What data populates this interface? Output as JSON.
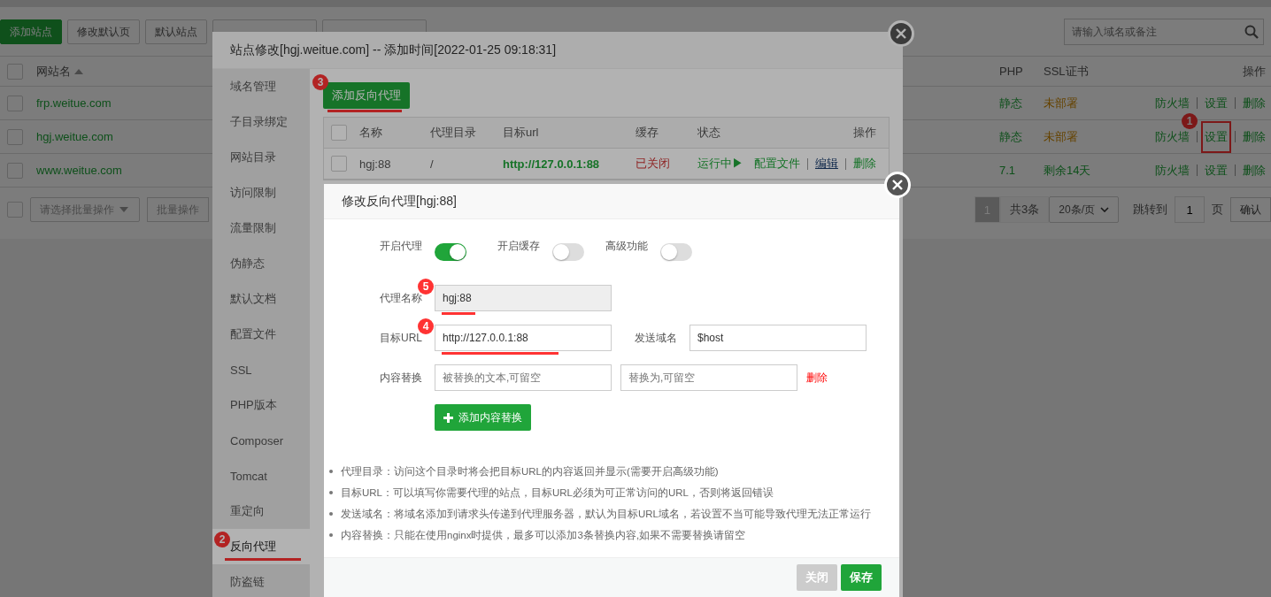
{
  "toolbar": {
    "buttons": [
      {
        "label": "添加站点",
        "primary": true
      },
      {
        "label": "修改默认页",
        "primary": false
      },
      {
        "label": "默认站点",
        "primary": false
      }
    ],
    "search": {
      "placeholder": "请输入域名或备注"
    }
  },
  "sites": {
    "columns": [
      "网站名",
      "PHP",
      "SSL证书",
      "操作"
    ],
    "header_checked": false,
    "footer_checked": false,
    "rows": [
      {
        "checked": false,
        "name": "frp.weitue.com",
        "php": "静态",
        "ssl": "未部署",
        "ssl_ok": false,
        "ops": [
          {
            "label": "防火墙"
          },
          {
            "label": "设置"
          },
          {
            "label": "删除"
          }
        ]
      },
      {
        "checked": false,
        "name": "hgj.weitue.com",
        "php": "静态",
        "ssl": "未部署",
        "ssl_ok": false,
        "ops": [
          {
            "label": "防火墙"
          },
          {
            "label": "设置",
            "badge": "1"
          },
          {
            "label": "删除"
          }
        ]
      },
      {
        "checked": false,
        "name": "www.weitue.com",
        "php": "7.1",
        "ssl": "剩余14天",
        "ssl_ok": true,
        "ops": [
          {
            "label": "防火墙"
          },
          {
            "label": "设置"
          },
          {
            "label": "删除"
          }
        ]
      }
    ],
    "batch_placeholder": "请选择批量操作",
    "batch_button": "批量操作",
    "pager": {
      "page": "1",
      "total": "共3条",
      "per_page": "20条/页",
      "jump": "跳转到",
      "jump_value": "1",
      "unit": "页",
      "confirm": "确认"
    }
  },
  "site_dialog": {
    "title": "站点修改[hgj.weitue.com] -- 添加时间[2022-01-25 09:18:31]",
    "menu": [
      {
        "label": "域名管理",
        "selected": false
      },
      {
        "label": "子目录绑定",
        "selected": false
      },
      {
        "label": "网站目录",
        "selected": false
      },
      {
        "label": "访问限制",
        "selected": false
      },
      {
        "label": "流量限制",
        "selected": false
      },
      {
        "label": "伪静态",
        "selected": false
      },
      {
        "label": "默认文档",
        "selected": false
      },
      {
        "label": "配置文件",
        "selected": false
      },
      {
        "label": "SSL",
        "selected": false
      },
      {
        "label": "PHP版本",
        "selected": false
      },
      {
        "label": "Composer",
        "selected": false
      },
      {
        "label": "Tomcat",
        "selected": false
      },
      {
        "label": "重定向",
        "selected": false
      },
      {
        "label": "反向代理",
        "selected": true,
        "badge": "2"
      },
      {
        "label": "防盗链",
        "selected": false
      }
    ],
    "add_button": {
      "label": "添加反向代理",
      "badge": "3"
    },
    "columns": [
      "名称",
      "代理目录",
      "目标url",
      "缓存",
      "状态",
      "操作"
    ],
    "header_checked": false,
    "rows": [
      {
        "checked": false,
        "name": "hgj:88",
        "dir": "/",
        "url": "http://127.0.0.1:88",
        "cache": "已关闭",
        "status": "运行中▶",
        "ops": [
          {
            "label": "配置文件",
            "underlined": false
          },
          {
            "label": "编辑",
            "underlined": true
          },
          {
            "label": "删除",
            "underlined": false
          }
        ]
      }
    ]
  },
  "proxy_dialog": {
    "title": "修改反向代理[hgj:88]",
    "switches": [
      {
        "label": "开启代理",
        "on": true
      },
      {
        "label": "开启缓存",
        "on": false
      },
      {
        "label": "高级功能",
        "on": false
      }
    ],
    "name_field": {
      "label": "代理名称",
      "value": "hgj:88",
      "disabled": true,
      "badge": "5"
    },
    "url_field": {
      "label": "目标URL",
      "value": "http://127.0.0.1:88",
      "badge": "4"
    },
    "host_field": {
      "label": "发送域名",
      "value": "$host"
    },
    "replace": {
      "label": "内容替换",
      "from_placeholder": "被替换的文本,可留空",
      "to_placeholder": "替换为,可留空",
      "delete": "删除"
    },
    "add_replace": "添加内容替换",
    "notes": [
      "代理目录：访问这个目录时将会把目标URL的内容返回并显示(需要开启高级功能)",
      "目标URL：可以填写你需要代理的站点，目标URL必须为可正常访问的URL，否则将返回错误",
      "发送域名：将域名添加到请求头传递到代理服务器，默认为目标URL域名，若设置不当可能导致代理无法正常运行",
      "内容替换：只能在使用nginx时提供，最多可以添加3条替换内容,如果不需要替换请留空"
    ],
    "buttons": [
      {
        "label": "关闭",
        "kind": "close"
      },
      {
        "label": "保存",
        "kind": "save"
      }
    ]
  }
}
